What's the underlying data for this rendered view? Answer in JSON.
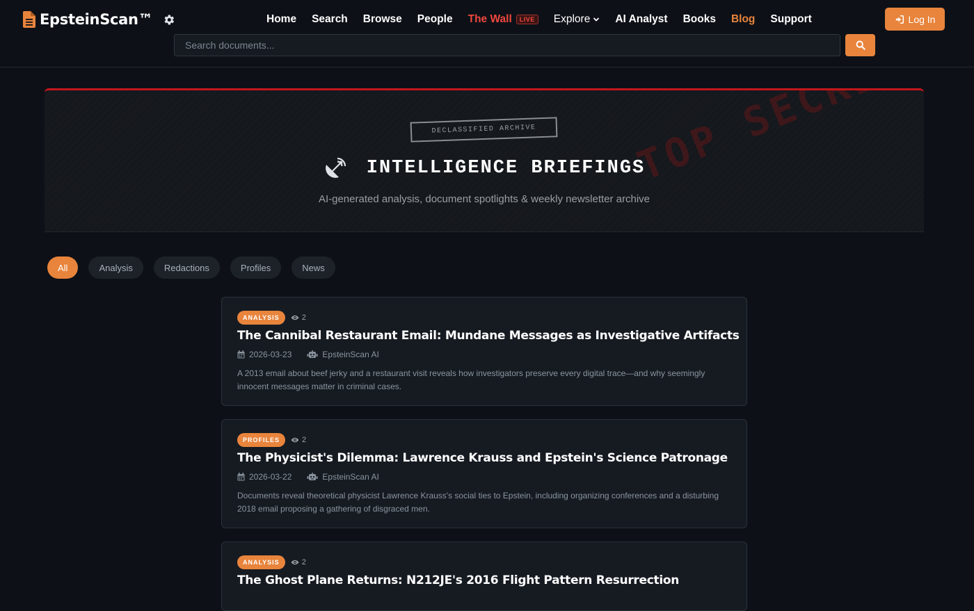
{
  "brand": {
    "name": "EpsteinScan™"
  },
  "nav": {
    "home": "Home",
    "search": "Search",
    "browse": "Browse",
    "people": "People",
    "wall": "The Wall",
    "wall_badge": "LIVE",
    "explore": "Explore",
    "ai_analyst": "AI Analyst",
    "books": "Books",
    "blog": "Blog",
    "support": "Support",
    "login": "Log In"
  },
  "search": {
    "placeholder": "Search documents..."
  },
  "hero": {
    "tag": "DECLASSIFIED ARCHIVE",
    "title": "INTELLIGENCE BRIEFINGS",
    "subtitle": "AI-generated analysis, document spotlights & weekly newsletter archive",
    "stamp": "TOP SECRET"
  },
  "filters": [
    "All",
    "Analysis",
    "Redactions",
    "Profiles",
    "News"
  ],
  "posts": [
    {
      "tag": "ANALYSIS",
      "views": "2",
      "title": "The Cannibal Restaurant Email: Mundane Messages as Investigative Artifacts",
      "date": "2026-03-23",
      "author": "EpsteinScan AI",
      "excerpt": "A 2013 email about beef jerky and a restaurant visit reveals how investigators preserve every digital trace—and why seemingly innocent messages matter in criminal cases."
    },
    {
      "tag": "PROFILES",
      "views": "2",
      "title": "The Physicist's Dilemma: Lawrence Krauss and Epstein's Science Patronage",
      "date": "2026-03-22",
      "author": "EpsteinScan AI",
      "excerpt": "Documents reveal theoretical physicist Lawrence Krauss's social ties to Epstein, including organizing conferences and a disturbing 2018 email proposing a gathering of disgraced men."
    },
    {
      "tag": "ANALYSIS",
      "views": "2",
      "title": "The Ghost Plane Returns: N212JE's 2016 Flight Pattern Resurrection",
      "date": "",
      "author": "",
      "excerpt": ""
    }
  ],
  "colors": {
    "accent": "#e8843c",
    "live_red": "#f0473e",
    "hero_border": "#c4161c",
    "background": "#0d1117",
    "card": "#161b22"
  }
}
